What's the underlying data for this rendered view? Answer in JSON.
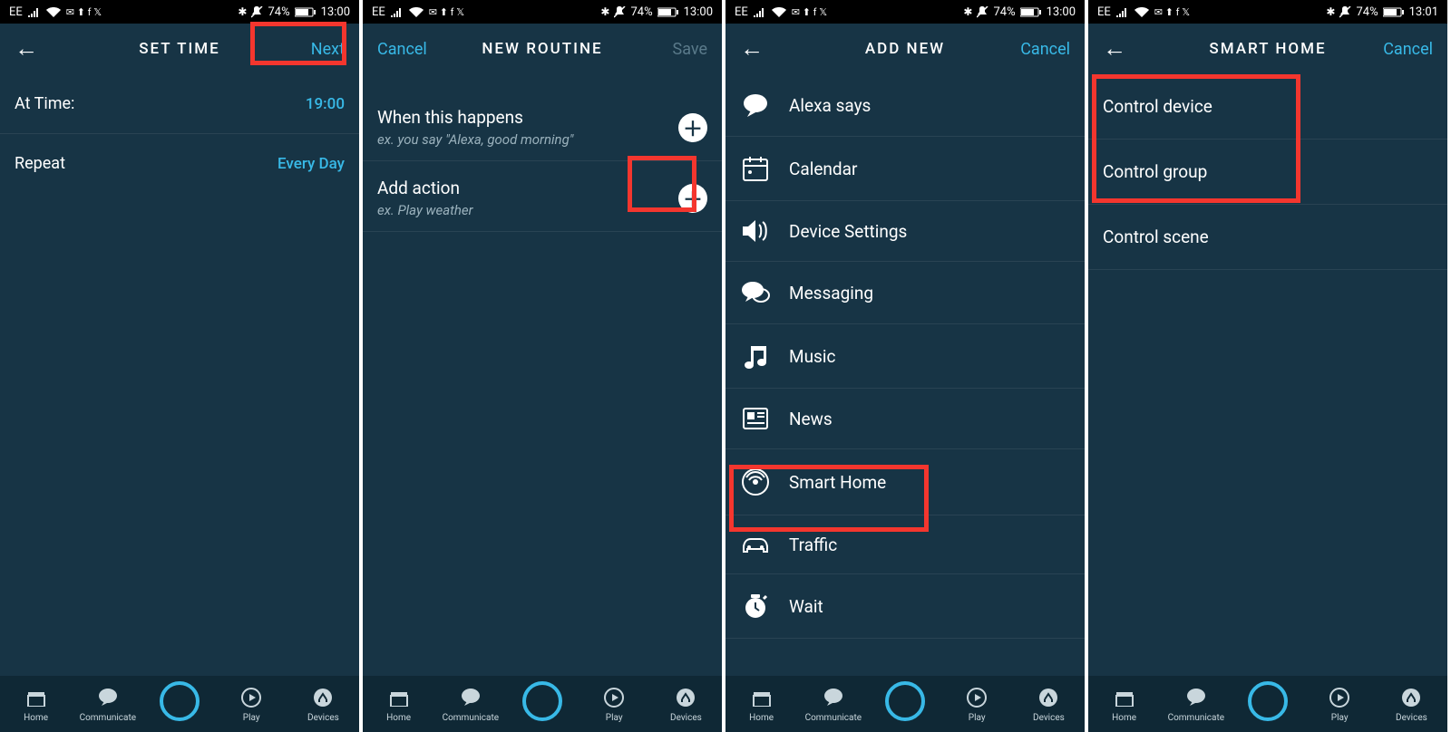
{
  "statusbar": {
    "carrier": "EE",
    "battery": "74%",
    "time_a": "13:00",
    "time_b": "13:01"
  },
  "tabs": {
    "home": "Home",
    "communicate": "Communicate",
    "play": "Play",
    "devices": "Devices"
  },
  "screen1": {
    "title": "SET TIME",
    "next": "Next",
    "at_label": "At Time:",
    "at_value": "19:00",
    "repeat_label": "Repeat",
    "repeat_value": "Every Day"
  },
  "screen2": {
    "cancel": "Cancel",
    "title": "NEW ROUTINE",
    "save": "Save",
    "when_title": "When this happens",
    "when_hint": "ex. you say \"Alexa, good morning\"",
    "action_title": "Add action",
    "action_hint": "ex. Play weather"
  },
  "screen3": {
    "title": "ADD NEW",
    "cancel": "Cancel",
    "items": [
      {
        "icon": "speech",
        "label": "Alexa says"
      },
      {
        "icon": "calendar",
        "label": "Calendar"
      },
      {
        "icon": "volume",
        "label": "Device Settings"
      },
      {
        "icon": "messaging",
        "label": "Messaging"
      },
      {
        "icon": "music",
        "label": "Music"
      },
      {
        "icon": "news",
        "label": "News"
      },
      {
        "icon": "smarthome",
        "label": "Smart Home"
      },
      {
        "icon": "traffic",
        "label": "Traffic"
      },
      {
        "icon": "wait",
        "label": "Wait"
      }
    ]
  },
  "screen4": {
    "title": "SMART HOME",
    "cancel": "Cancel",
    "items": [
      "Control device",
      "Control group",
      "Control scene"
    ]
  }
}
